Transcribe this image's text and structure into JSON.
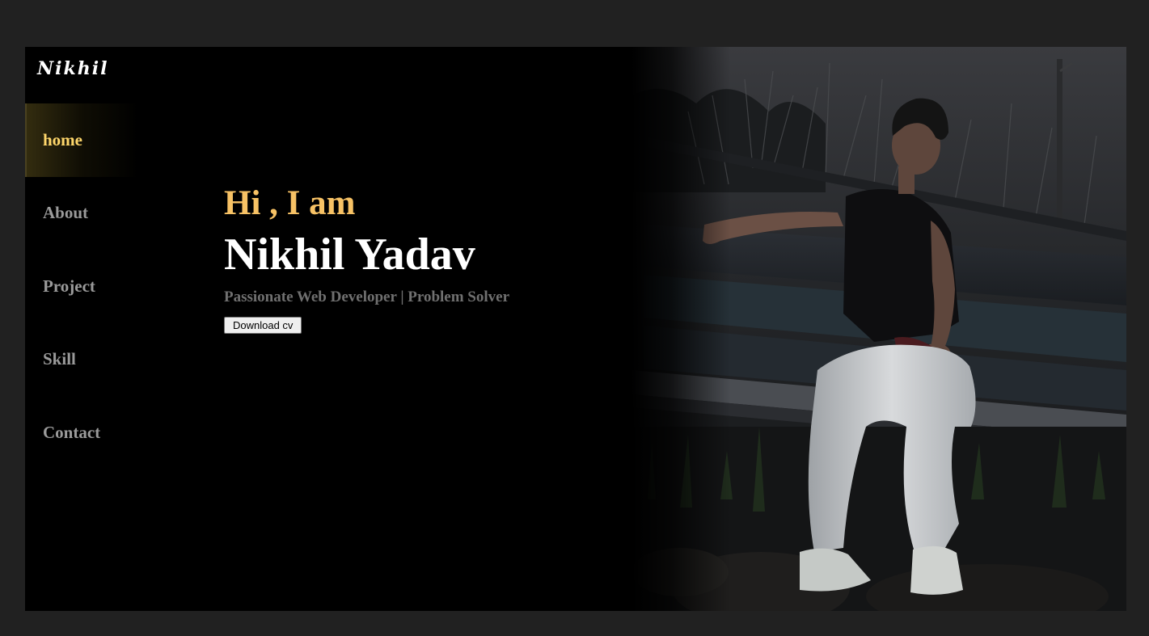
{
  "brand": {
    "logo_text": "Nikhil"
  },
  "nav": {
    "items": [
      {
        "label": "home",
        "active": true
      },
      {
        "label": "About",
        "active": false
      },
      {
        "label": "Project",
        "active": false
      },
      {
        "label": "Skill",
        "active": false
      },
      {
        "label": "Contact",
        "active": false
      }
    ]
  },
  "hero": {
    "greeting": "Hi , I am",
    "name": "Nikhil Yadav",
    "tagline": "Passionate Web Developer | Problem Solver",
    "cv_button_label": "Download cv"
  },
  "colors": {
    "accent": "#f7c265",
    "nav_active": "#ffd76b",
    "background": "#000000",
    "page_bg": "#212121"
  }
}
